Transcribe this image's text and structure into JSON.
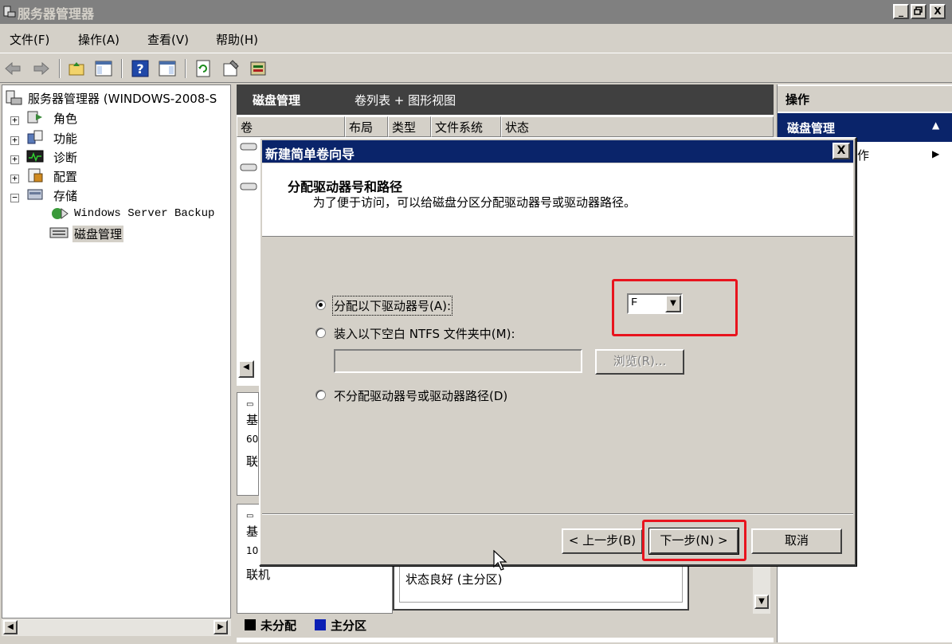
{
  "window": {
    "title": "服务器管理器",
    "controls": [
      "_",
      "▫",
      "X"
    ]
  },
  "menu": [
    "文件(F)",
    "操作(A)",
    "查看(V)",
    "帮助(H)"
  ],
  "tree": {
    "root": "服务器管理器 (WINDOWS-2008-S",
    "items": [
      {
        "label": "角色",
        "expander": "+"
      },
      {
        "label": "功能",
        "expander": "+"
      },
      {
        "label": "诊断",
        "expander": "+"
      },
      {
        "label": "配置",
        "expander": "+"
      },
      {
        "label": "存储",
        "expander": "−"
      }
    ],
    "storage_children": [
      "Windows Server Backup",
      "磁盘管理"
    ]
  },
  "center": {
    "header_title": "磁盘管理",
    "header_view": "卷列表 + 图形视图",
    "columns": [
      "卷",
      "布局",
      "类型",
      "文件系统",
      "状态"
    ],
    "disk_fragments": [
      "基",
      "60",
      "联",
      "基",
      "10",
      "联机"
    ],
    "partition_status": "状态良好 (主分区)",
    "legend": [
      {
        "label": "未分配",
        "color": "#000000"
      },
      {
        "label": "主分区",
        "color": "#0a1eb4"
      }
    ]
  },
  "actions": {
    "header": "操作",
    "section": "磁盘管理",
    "more": "作"
  },
  "dialog": {
    "title": "新建简单卷向导",
    "close": "X",
    "heading": "分配驱动器号和路径",
    "description": "为了便于访问，可以给磁盘分区分配驱动器号或驱动器路径。",
    "options": [
      {
        "label": "分配以下驱动器号(A):",
        "checked": true
      },
      {
        "label": "装入以下空白 NTFS 文件夹中(M):",
        "checked": false
      },
      {
        "label": "不分配驱动器号或驱动器路径(D)",
        "checked": false
      }
    ],
    "drive_letter": "F",
    "folder_path": "",
    "browse_label": "浏览(R)...",
    "back_label": "< 上一步(B)",
    "next_label": "下一步(N) >",
    "cancel_label": "取消"
  }
}
